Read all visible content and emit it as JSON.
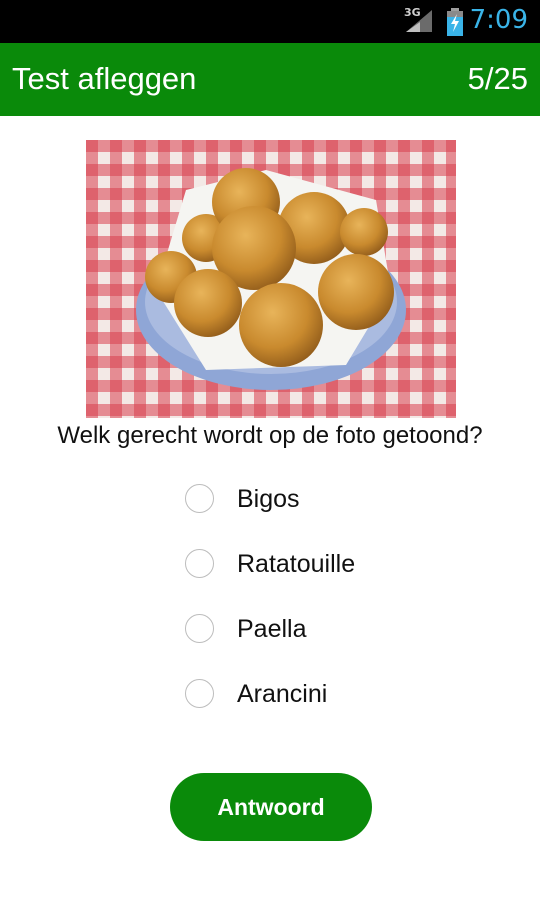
{
  "status_bar": {
    "network": "3G",
    "time": "7:09",
    "icons": [
      "signal-icon",
      "battery-charging-icon"
    ],
    "clock_color": "#3ab4e8"
  },
  "header": {
    "title": "Test afleggen",
    "progress": "5/25",
    "color": "#0a8a0a"
  },
  "photo": {
    "subject": "food-photo"
  },
  "question": "Welk gerecht wordt op de foto getoond?",
  "options": [
    "Bigos",
    "Ratatouille",
    "Paella",
    "Arancini"
  ],
  "answer_button": "Antwoord"
}
